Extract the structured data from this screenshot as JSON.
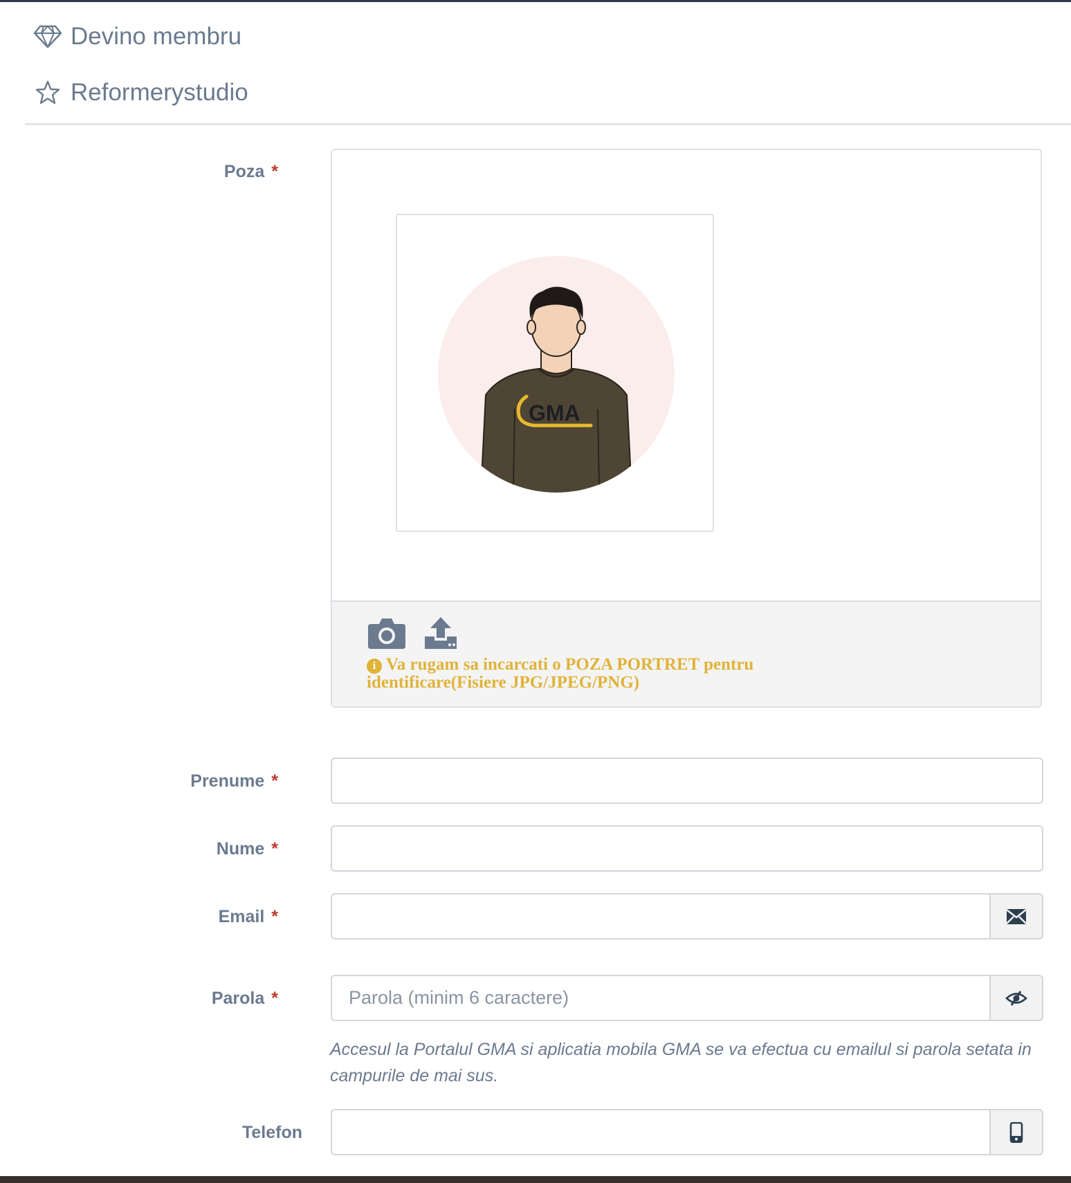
{
  "header": {
    "become_member": "Devino membru",
    "studio_name": "Reformerystudio"
  },
  "form": {
    "photo": {
      "label": "Poza",
      "avatar_logo_text": "GMA",
      "note": "Va rugam sa incarcati o POZA PORTRET pentru identificare(Fisiere JPG/JPEG/PNG)",
      "icons": [
        "camera-icon",
        "upload-icon",
        "info-icon"
      ]
    },
    "first_name": {
      "label": "Prenume",
      "value": "",
      "placeholder": ""
    },
    "last_name": {
      "label": "Nume",
      "value": "",
      "placeholder": ""
    },
    "email": {
      "label": "Email",
      "value": "",
      "placeholder": "",
      "icon": "envelope-icon"
    },
    "password": {
      "label": "Parola",
      "value": "",
      "placeholder": "Parola (minim 6 caractere)",
      "icon": "eye-slash-icon"
    },
    "access_help": "Accesul la Portalul GMA si aplicatia mobila GMA se va efectua cu emailul si parola setata in campurile de mai sus.",
    "phone": {
      "label": "Telefon",
      "value": "",
      "placeholder": "",
      "icon": "mobile-phone-icon"
    },
    "required_marker": "*"
  },
  "colors": {
    "label": "#6b7a8f",
    "required": "#c0392b",
    "note": "#e0b339",
    "border": "#d2d6dc",
    "avatar_bg": "#fbedeb",
    "shirt": "#4e4535"
  }
}
